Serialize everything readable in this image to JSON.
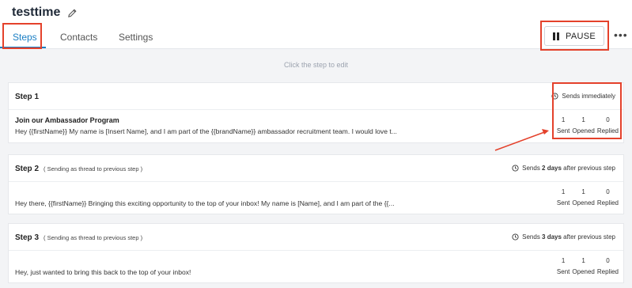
{
  "campaign": {
    "title": "testtime"
  },
  "tabs": [
    {
      "label": "Steps",
      "active": true
    },
    {
      "label": "Contacts",
      "active": false
    },
    {
      "label": "Settings",
      "active": false
    }
  ],
  "toolbar": {
    "pause_label": "PAUSE",
    "more_label": "•••"
  },
  "hint": "Click the step to edit",
  "steps": [
    {
      "label": "Step 1",
      "thread_note": "",
      "sends": "Sends immediately",
      "sends_days": "",
      "sends_suffix": "",
      "subject": "Join our Ambassador Program",
      "body": "Hey {{firstName}} My name is [Insert Name], and I am part of the {{brandName}} ambassador recruitment team. I would love t...",
      "stats": {
        "sent": "1",
        "opened": "1",
        "replied": "0"
      }
    },
    {
      "label": "Step 2",
      "thread_note": "( Sending as thread to previous step )",
      "sends": "Sends ",
      "sends_days": "2 days",
      "sends_suffix": " after previous step",
      "subject": "",
      "body": "Hey there, {{firstName}} Bringing this exciting opportunity to the top of your inbox! My name is [Name], and I am part of the {{...",
      "stats": {
        "sent": "1",
        "opened": "1",
        "replied": "0"
      }
    },
    {
      "label": "Step 3",
      "thread_note": "( Sending as thread to previous step )",
      "sends": "Sends ",
      "sends_days": "3 days",
      "sends_suffix": " after previous step",
      "subject": "",
      "body": "Hey, just wanted to bring this back to the top of your inbox!",
      "stats": {
        "sent": "1",
        "opened": "1",
        "replied": "0"
      }
    }
  ],
  "stat_labels": {
    "sent": "Sent",
    "opened": "Opened",
    "replied": "Replied"
  },
  "colors": {
    "accent": "#1b7fc4",
    "annotation": "#e4412b"
  }
}
